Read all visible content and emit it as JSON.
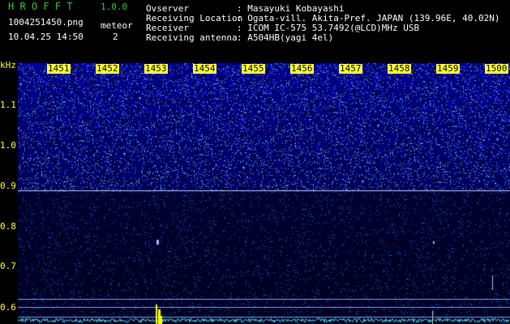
{
  "app": {
    "name": "H R O F F T",
    "version": "1.0.0",
    "filename": "1004251450.png",
    "datetime": "10.04.25 14:50",
    "meteor_label": "meteor",
    "meteor_count": "2"
  },
  "station": {
    "labels": [
      "Ovserver",
      "Receiving Location",
      "Receiver",
      "Receiving antenna"
    ],
    "values": [
      ": Masayuki Kobayashi",
      ": Ogata-vill. Akita-Pref. JAPAN (139.96E, 40.02N)",
      ": ICOM IC-575 53.7492(@LCD)MHz USB",
      ": A504HB(yagi 4el)"
    ]
  },
  "axis": {
    "unit": "kHz",
    "freq_labels": [
      "1.1",
      "1.0",
      "0.9",
      "0.8",
      "0.7",
      "0.6"
    ],
    "time_labels": [
      "1451",
      "1452",
      "1453",
      "1454",
      "1455",
      "1456",
      "1457",
      "1458",
      "1459",
      "1500"
    ]
  },
  "colors": {
    "text_green": "#33cc33",
    "text_white": "#ffffff",
    "text_yellow": "#ffff33",
    "background": "#000000",
    "noise_dark": "#000a3a",
    "noise_bright": "#4060ff",
    "carrier_line": "#ccccff",
    "spectrum_trace": "#4fe0e0",
    "meteor_echo": "#ffff00"
  }
}
